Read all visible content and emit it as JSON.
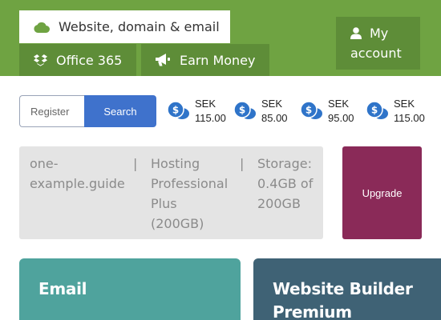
{
  "tabs": {
    "active": {
      "label": "Website, domain & email",
      "icon": "cloud-icon"
    },
    "office": {
      "label": "Office 365",
      "icon": "dropbox-icon"
    },
    "earn": {
      "label": "Earn Money",
      "icon": "megaphone-icon"
    }
  },
  "account": {
    "line1": "My",
    "line2": "account",
    "icon": "user-icon"
  },
  "search": {
    "placeholder": "Register",
    "button": "Search"
  },
  "prices": [
    {
      "currency": "SEK",
      "amount": "115.00"
    },
    {
      "currency": "SEK",
      "amount": "85.00"
    },
    {
      "currency": "SEK",
      "amount": "95.00"
    },
    {
      "currency": "SEK",
      "amount": "115.00"
    }
  ],
  "info": {
    "domain_line1": "one-",
    "domain_line2": "example.guide",
    "separator": "|",
    "plan_line1": "Hosting",
    "plan_line2": "Professional",
    "plan_line3": "Plus",
    "plan_line4": "(200GB)",
    "storage_line1": "Storage:",
    "storage_line2": "0.4GB of",
    "storage_line3": "200GB"
  },
  "upgrade": {
    "label": "Upgrade"
  },
  "cards": {
    "email": {
      "title": "Email"
    },
    "builder": {
      "title_line1": "Website Builder",
      "title_line2": "Premium"
    }
  },
  "colors": {
    "header_green": "#6fa342",
    "tab_dark_green": "#5e8d38",
    "search_blue": "#3f72cc",
    "upgrade_purple": "#8a2a58",
    "email_teal": "#4fa39d",
    "builder_slate": "#3f6275",
    "coin_blue": "#2f74c9"
  }
}
